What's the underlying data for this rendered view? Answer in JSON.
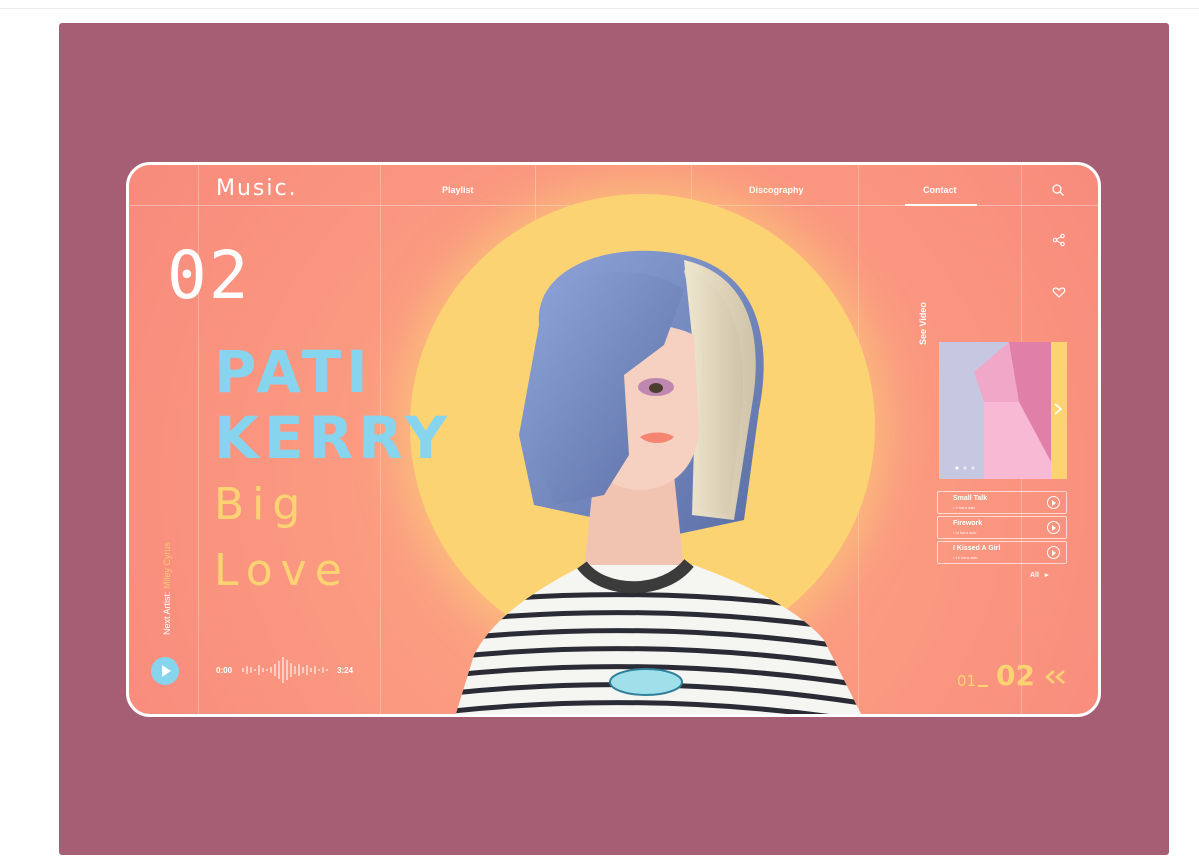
{
  "header": {
    "logo": "Music.",
    "nav": [
      {
        "label": "Playlist"
      },
      {
        "label": "Discography"
      },
      {
        "label": "Contact",
        "active": true
      }
    ],
    "icons": [
      "search-icon"
    ]
  },
  "side_icons": [
    "share-icon",
    "heart-icon"
  ],
  "hero": {
    "track_number": "02",
    "artist_line1": "PATI",
    "artist_line2": "KERRY",
    "song_line1": "Big",
    "song_line2": "Love"
  },
  "next_artist": {
    "label": "Next Artist:",
    "name": "Miley Cyrus"
  },
  "player": {
    "current_time": "0:00",
    "duration": "3:24"
  },
  "video": {
    "label": "See Video"
  },
  "tracks": [
    {
      "name": "Small Talk",
      "meta": "• 4 bara aalc"
    },
    {
      "name": "Firework",
      "meta": "• 4t bara aalc"
    },
    {
      "name": "I Kissed A Girl",
      "meta": "• 1b bara aalc"
    }
  ],
  "tracks_all": "All",
  "pagination": {
    "current": "01",
    "total": "02"
  },
  "colors": {
    "stage": "#a55e73",
    "card": "#f88a7c",
    "sun": "#fbd373",
    "accent_blue": "#86d4ee",
    "accent_yellow": "#fbd373"
  }
}
